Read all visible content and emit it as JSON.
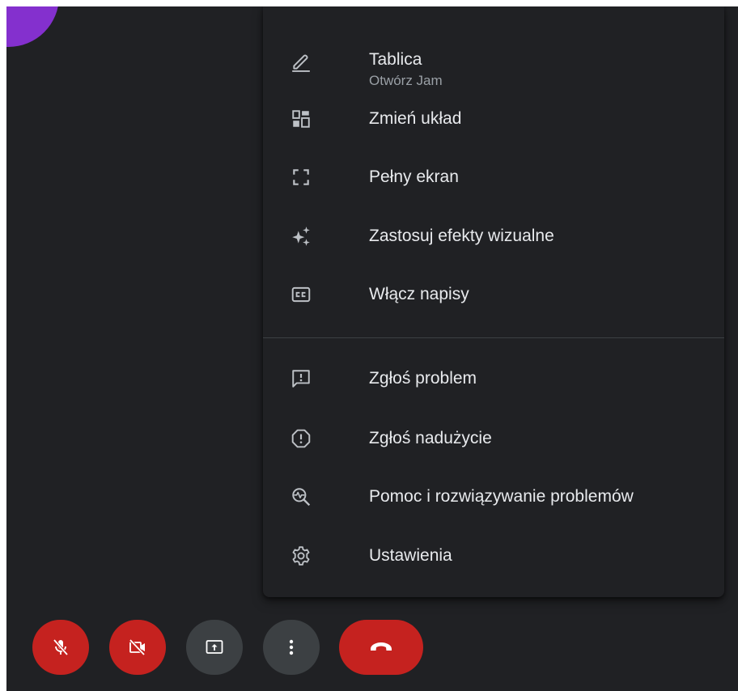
{
  "menu": {
    "items": [
      {
        "label": "Tablica",
        "sublabel": "Otwórz Jam",
        "icon": "pencil-icon"
      },
      {
        "label": "Zmień układ",
        "icon": "layout-icon"
      },
      {
        "label": "Pełny ekran",
        "icon": "fullscreen-icon"
      },
      {
        "label": "Zastosuj efekty wizualne",
        "icon": "sparkle-icon"
      },
      {
        "label": "Włącz napisy",
        "icon": "closed-captions-icon"
      },
      {
        "label": "Zgłoś problem",
        "icon": "feedback-icon"
      },
      {
        "label": "Zgłoś nadużycie",
        "icon": "report-icon"
      },
      {
        "label": "Pomoc i rozwiązywanie problemów",
        "icon": "troubleshoot-icon"
      },
      {
        "label": "Ustawienia",
        "icon": "gear-icon"
      }
    ]
  },
  "controls": [
    {
      "icon": "mic-off-icon",
      "color": "#c5221f"
    },
    {
      "icon": "camera-off-icon",
      "color": "#c5221f"
    },
    {
      "icon": "present-screen-icon",
      "color": "#3c4043"
    },
    {
      "icon": "more-options-icon",
      "color": "#3c4043"
    },
    {
      "icon": "hang-up-icon",
      "color": "#c5221f"
    }
  ],
  "colors": {
    "background": "#202124",
    "menu_text": "#e8eaed",
    "menu_subtext": "#9aa0a6",
    "icon": "#bdc1c6",
    "danger": "#c5221f",
    "neutral_button": "#3c4043",
    "avatar": "#8430ce"
  }
}
